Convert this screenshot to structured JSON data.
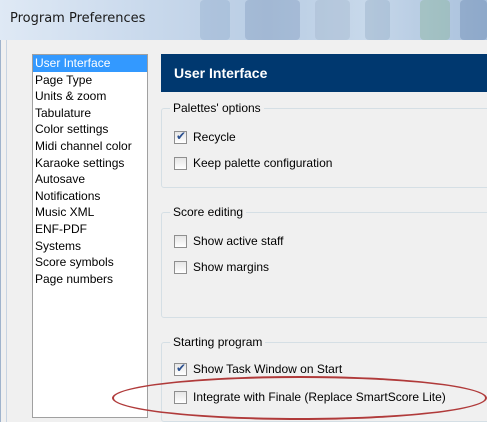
{
  "window": {
    "title": "Program Preferences"
  },
  "sidebar": {
    "items": [
      {
        "label": "User Interface",
        "selected": true
      },
      {
        "label": "Page Type"
      },
      {
        "label": "Units & zoom"
      },
      {
        "label": "Tabulature"
      },
      {
        "label": "Color settings"
      },
      {
        "label": "Midi channel color"
      },
      {
        "label": "Karaoke settings"
      },
      {
        "label": "Autosave"
      },
      {
        "label": "Notifications"
      },
      {
        "label": "Music XML"
      },
      {
        "label": "ENF-PDF"
      },
      {
        "label": "Systems"
      },
      {
        "label": "Score symbols"
      },
      {
        "label": "Page numbers"
      }
    ]
  },
  "panel": {
    "title": "User Interface",
    "groups": {
      "palettes": {
        "label": "Palettes' options",
        "recycle": {
          "label": "Recycle",
          "checked": true
        },
        "keep_config": {
          "label": "Keep palette configuration",
          "checked": false
        }
      },
      "score_editing": {
        "label": "Score editing",
        "show_active_staff": {
          "label": "Show active staff",
          "checked": false
        },
        "show_margins": {
          "label": "Show margins",
          "checked": false
        }
      },
      "starting": {
        "label": "Starting program",
        "show_task_window": {
          "label": "Show Task Window on Start",
          "checked": true
        },
        "integrate_finale": {
          "label": "Integrate with Finale (Replace SmartScore Lite)",
          "checked": false
        }
      }
    }
  },
  "colors": {
    "header_bg": "#00386f",
    "selection": "#3399ff",
    "annotation": "#b03a3a"
  },
  "checkmark": "✔"
}
